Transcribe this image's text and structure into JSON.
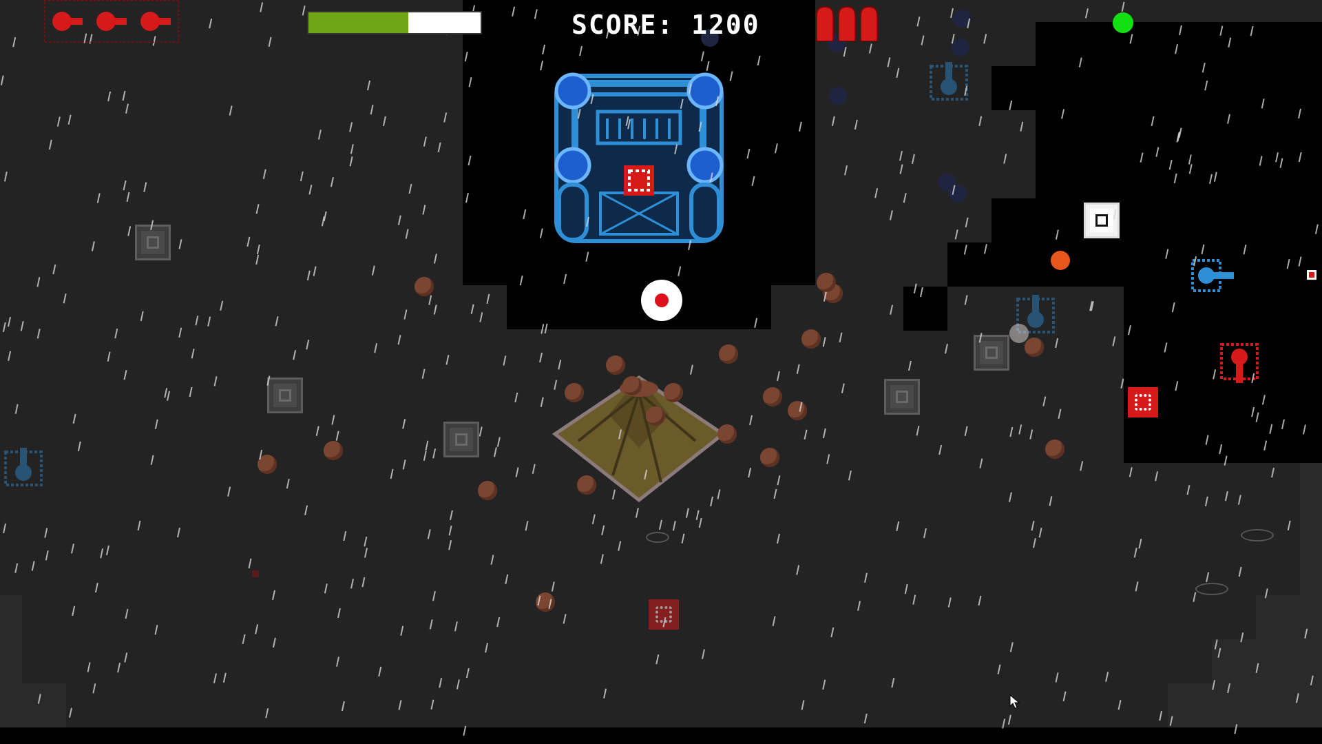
{
  "hud": {
    "score_text": "SCORE: 1200",
    "health_fraction": 0.58,
    "lives_remaining": 3,
    "ammo_shells": 3,
    "status_indicator": "green"
  },
  "colors": {
    "ground": "#232323",
    "fog": "#000000",
    "health_fill": "#6fa617",
    "health_empty": "#ffffff",
    "status_online": "#12e012",
    "enemy_red": "#d61a1a",
    "ally_blue": "#2f8fd6"
  },
  "icons": {
    "lives": "red-turret-icon",
    "ammo": "red-shell-icon",
    "boss": "blue-fortress-boss",
    "player": "player-tank-icon",
    "pickup": "medkit-icon",
    "crate": "supply-crate-icon",
    "volcano": "volcano-icon",
    "cursor": "mouse-cursor-icon"
  }
}
